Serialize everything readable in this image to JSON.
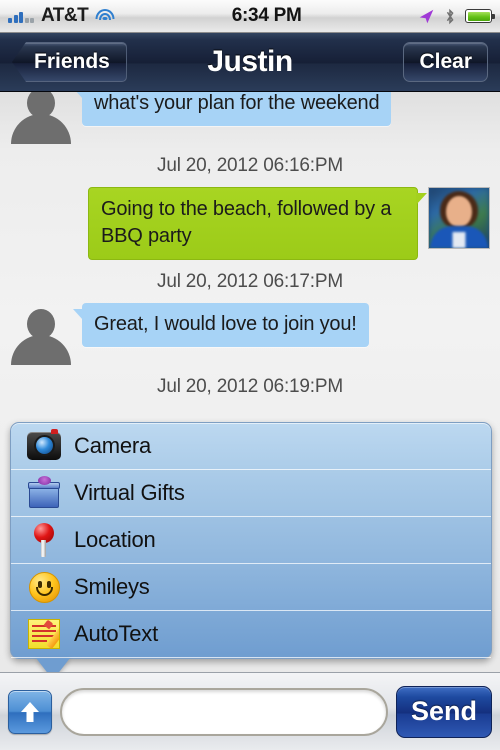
{
  "status_bar": {
    "carrier": "AT&T",
    "time": "6:34 PM",
    "icons": [
      "signal-bars-icon",
      "wifi-icon",
      "location-arrow-icon",
      "bluetooth-icon",
      "battery-icon"
    ],
    "signal_bars_filled": 3,
    "signal_bars_total": 5,
    "battery_color": "#63c016",
    "location_arrow_color": "#a03ad6"
  },
  "navbar": {
    "back_label": "Friends",
    "title": "Justin",
    "clear_label": "Clear",
    "background_color": "#161f36"
  },
  "chat": {
    "messages": [
      {
        "direction": "incoming",
        "text": "what's your plan for the weekend",
        "avatar": "placeholder-silhouette",
        "clipped_top": true
      },
      {
        "timestamp": "Jul 20, 2012 06:16:PM"
      },
      {
        "direction": "outgoing",
        "text": "Going to the beach, followed by a BBQ party",
        "avatar": "user-photo"
      },
      {
        "timestamp": "Jul 20, 2012 06:17:PM"
      },
      {
        "direction": "incoming",
        "text": "Great, I would love to join you!",
        "avatar": "placeholder-silhouette"
      },
      {
        "timestamp": "Jul 20, 2012 06:19:PM"
      }
    ],
    "incoming_bubble_color": "#a7d3f6",
    "outgoing_bubble_color": "#a4d11e"
  },
  "popup_menu": {
    "items": [
      {
        "label": "Camera",
        "icon": "camera-icon"
      },
      {
        "label": "Virtual Gifts",
        "icon": "gift-icon"
      },
      {
        "label": "Location",
        "icon": "location-pin-icon"
      },
      {
        "label": "Smileys",
        "icon": "smiley-icon"
      },
      {
        "label": "AutoText",
        "icon": "notepad-pencil-icon"
      }
    ]
  },
  "toolbar": {
    "attach_icon": "up-arrow-icon",
    "message_value": "",
    "message_placeholder": "",
    "send_label": "Send",
    "send_color": "#142f7e"
  }
}
